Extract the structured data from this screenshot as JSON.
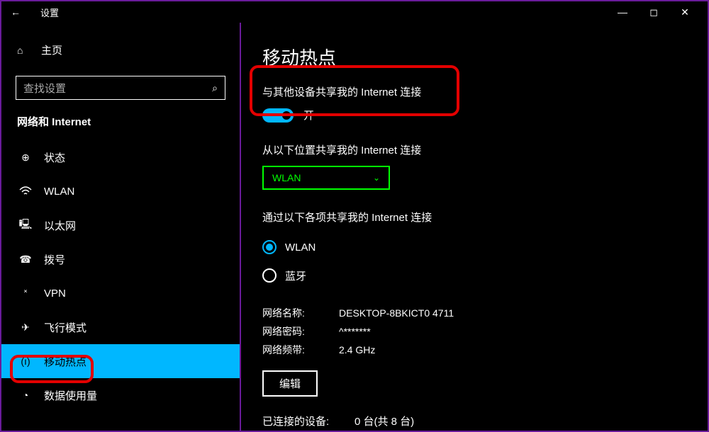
{
  "titlebar": {
    "title": "设置"
  },
  "sidebar": {
    "home": "主页",
    "search_placeholder": "查找设置",
    "category": "网络和 Internet",
    "items": [
      {
        "label": "状态"
      },
      {
        "label": "WLAN"
      },
      {
        "label": "以太网"
      },
      {
        "label": "拨号"
      },
      {
        "label": "VPN"
      },
      {
        "label": "飞行模式"
      },
      {
        "label": "移动热点"
      },
      {
        "label": "数据使用量"
      }
    ]
  },
  "main": {
    "title": "移动热点",
    "share_label": "与其他设备共享我的 Internet 连接",
    "toggle_state": "开",
    "from_label": "从以下位置共享我的 Internet 连接",
    "dropdown_value": "WLAN",
    "via_label": "通过以下各项共享我的 Internet 连接",
    "radio_options": [
      {
        "label": "WLAN",
        "selected": true
      },
      {
        "label": "蓝牙",
        "selected": false
      }
    ],
    "info": {
      "name_key": "网络名称:",
      "name_value": "DESKTOP-8BKICT0 4711",
      "pass_key": "网络密码:",
      "pass_value": "^*******",
      "band_key": "网络频带:",
      "band_value": "2.4 GHz"
    },
    "edit_button": "编辑",
    "connected_key": "已连接的设备:",
    "connected_value": "0 台(共 8 台)"
  }
}
